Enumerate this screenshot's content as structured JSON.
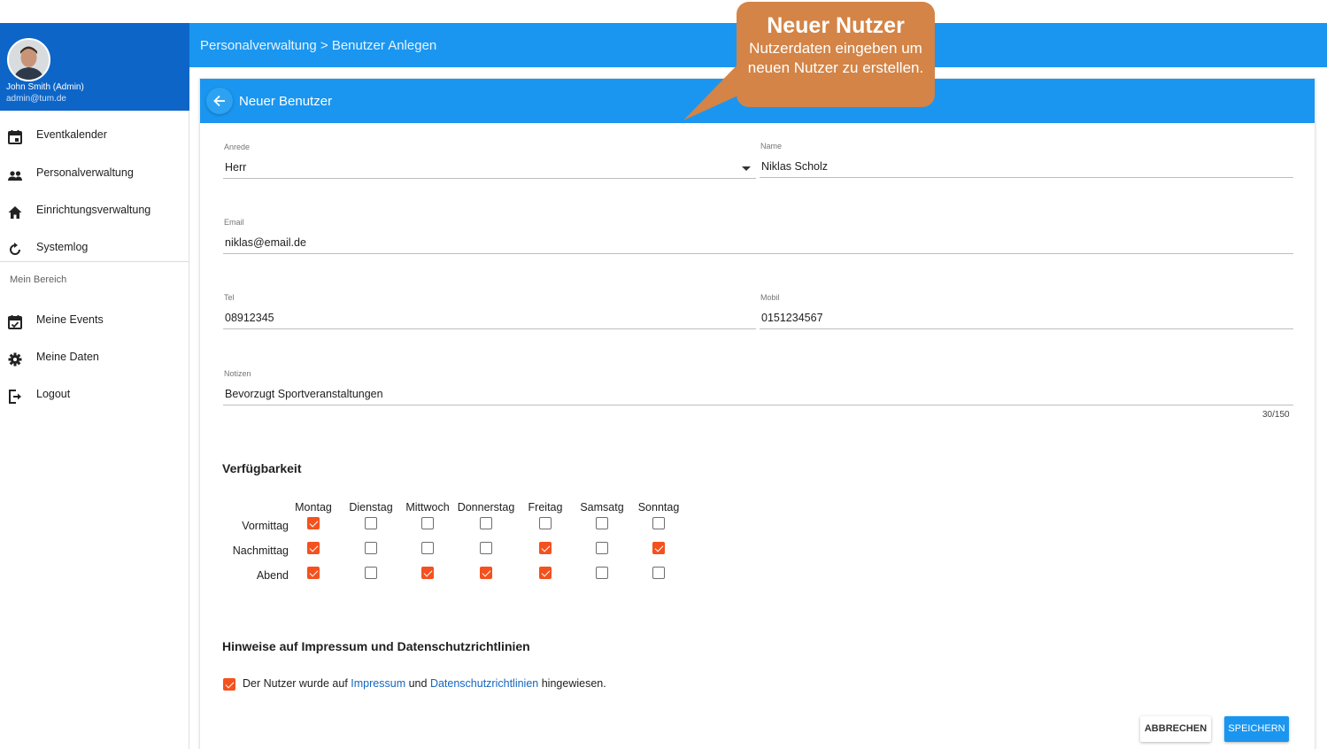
{
  "sidebar": {
    "user_name": "John Smith (Admin)",
    "user_email": "admin@tum.de",
    "items": [
      {
        "label": "Eventkalender",
        "icon": "calendar-icon"
      },
      {
        "label": "Personalverwaltung",
        "icon": "people-icon"
      },
      {
        "label": "Einrichtungsverwaltung",
        "icon": "home-icon"
      },
      {
        "label": "Systemlog",
        "icon": "refresh-icon"
      }
    ],
    "subheader": "Mein Bereich",
    "personal_items": [
      {
        "label": "Meine Events",
        "icon": "calendar-check-icon"
      },
      {
        "label": "Meine Daten",
        "icon": "gear-icon"
      },
      {
        "label": "Logout",
        "icon": "logout-icon"
      }
    ]
  },
  "header": {
    "breadcrumb": "Personalverwaltung > Benutzer Anlegen"
  },
  "card": {
    "title": "Neuer Benutzer",
    "back_icon": "arrow-left-icon"
  },
  "form": {
    "anrede": {
      "label": "Anrede",
      "value": "Herr"
    },
    "name": {
      "label": "Name",
      "value": "Niklas Scholz"
    },
    "email": {
      "label": "Email",
      "value": "niklas@email.de"
    },
    "tel": {
      "label": "Tel",
      "value": "08912345"
    },
    "mobil": {
      "label": "Mobil",
      "value": "0151234567"
    },
    "notizen": {
      "label": "Notizen",
      "value": "Bevorzugt Sportveranstaltungen",
      "counter": "30/150"
    }
  },
  "availability": {
    "title": "Verfügbarkeit",
    "days": [
      "Montag",
      "Dienstag",
      "Mittwoch",
      "Donnerstag",
      "Freitag",
      "Samsatg",
      "Sonntag"
    ],
    "slots": [
      {
        "label": "Vormittag",
        "checked": [
          true,
          false,
          false,
          false,
          false,
          false,
          false
        ]
      },
      {
        "label": "Nachmittag",
        "checked": [
          true,
          false,
          false,
          false,
          true,
          false,
          true
        ]
      },
      {
        "label": "Abend",
        "checked": [
          true,
          false,
          true,
          true,
          true,
          false,
          false
        ]
      }
    ]
  },
  "legal": {
    "title": "Hinweise auf Impressum und Datenschutzrichtlinien",
    "checked": true,
    "text_before": "Der Nutzer wurde auf",
    "link_impressum": "Impressum",
    "text_and": "und",
    "link_privacy": "Datenschutzrichtlinien",
    "text_after": "hingewiesen."
  },
  "actions": {
    "cancel_label": "ABBRECHEN",
    "save_label": "SPEICHERN"
  },
  "callout": {
    "title": "Neuer Nutzer",
    "text": "Nutzerdaten eingeben um neuen Nutzer zu erstellen."
  },
  "colors": {
    "primary": "#1a96f0",
    "sidebar_header": "#0d65c8",
    "checkbox_checked": "#f4511e",
    "callout": "#d38446",
    "link": "#1565c0"
  }
}
